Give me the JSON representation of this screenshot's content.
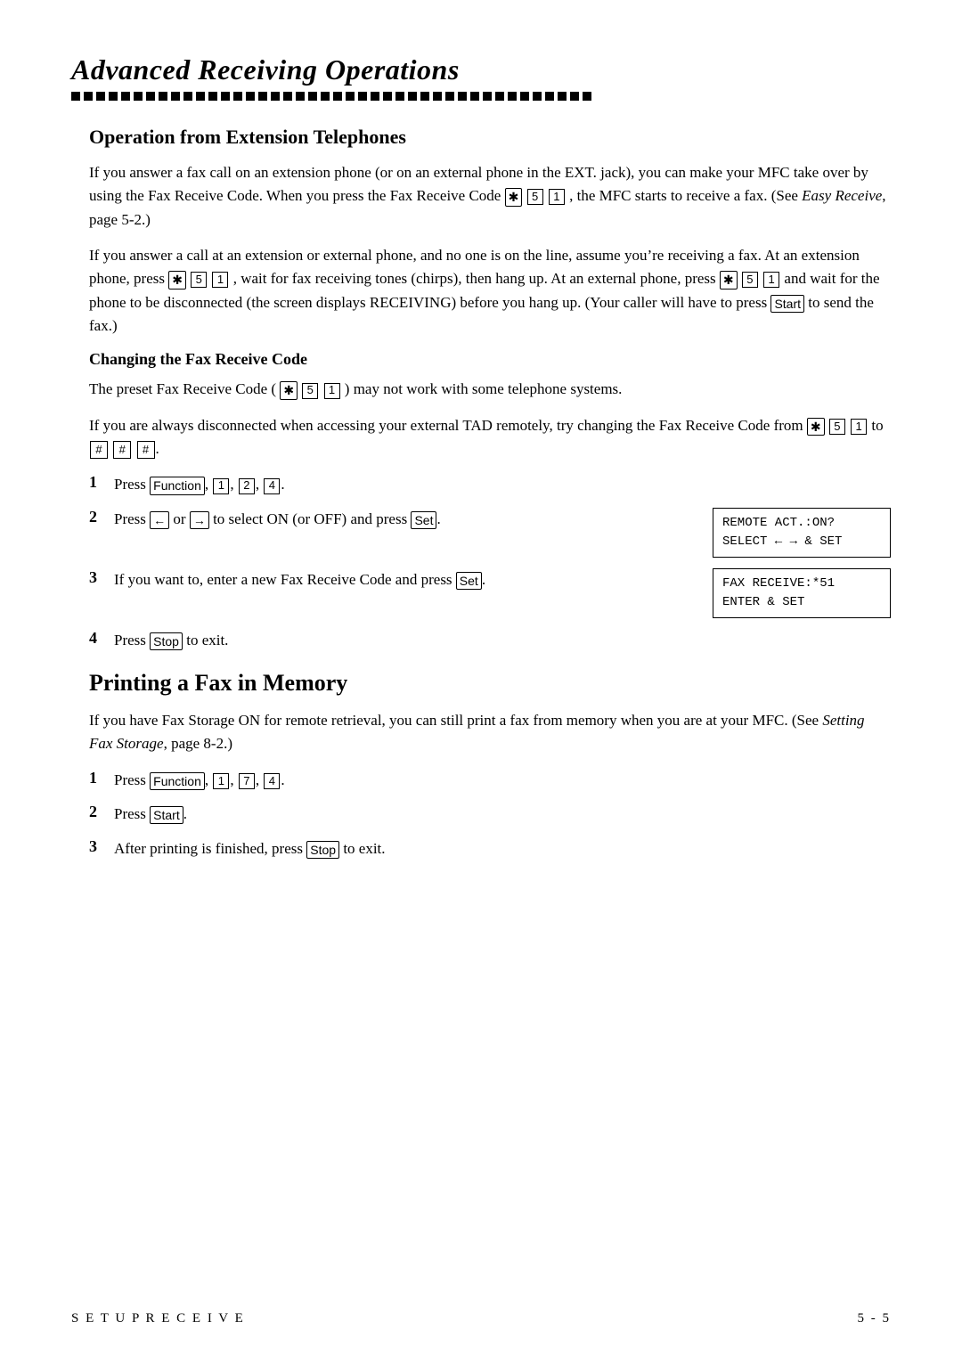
{
  "page": {
    "title": "Advanced Receiving Operations",
    "dots_count": 42,
    "section1": {
      "title": "Operation from Extension Telephones",
      "para1": "If you answer a fax call on an extension phone (or on an external phone in the EXT. jack), you can make your MFC take over by using the Fax Receive Code. When you press the Fax Receive Code",
      "para1_code": "✱ 5 1",
      "para1_end": ", the MFC starts to receive a fax. (See",
      "para1_italic": "Easy Receive",
      "para1_page": ", page 5-2.)",
      "para2": "If you answer a call at an extension or external phone, and no one is on the line, assume you’re receiving a fax. At an extension phone, press",
      "para2_code": "✱ 5 1",
      "para2_mid": ", wait for fax receiving tones (chirps), then hang up.  At an external phone, press",
      "para2_code2": "✱ 5 1",
      "para2_end": "and wait for the phone to be disconnected (the screen displays RECEIVING) before you hang up. (Your caller will have to press",
      "para2_start_btn": "Start",
      "para2_final": "to send the fax.)",
      "subsection": {
        "title": "Changing the Fax Receive Code",
        "para1": "The preset Fax Receive Code (",
        "para1_code": "✱ 5 1",
        "para1_end": ") may not work with some telephone systems.",
        "para2": "If you are always disconnected when accessing your external TAD remotely, try changing the Fax Receive Code from",
        "para2_from": "✱ 5 1",
        "para2_to": "to",
        "para2_to_code": "# # #",
        "steps": [
          {
            "num": "1",
            "text": "Press",
            "btn": "Function",
            "after": ",",
            "keys": [
              "1",
              "2",
              "4"
            ],
            "display": null
          },
          {
            "num": "2",
            "text_pre": "Press",
            "btn_left": "←",
            "or": "or",
            "btn_right": "→",
            "text_after": "to select ON (or OFF) and press",
            "btn_end": "Set",
            "display": "REMOTE ACT.:ON?\nSELECT ← → & SET"
          },
          {
            "num": "3",
            "text": "If you want to, enter a new Fax Receive Code and press",
            "btn": "Set",
            "display": "FAX RECEIVE:*51\nENTER & SET"
          },
          {
            "num": "4",
            "text": "Press",
            "btn": "Stop",
            "after": "to exit."
          }
        ]
      }
    },
    "section2": {
      "title": "Printing a Fax in Memory",
      "para1": "If you have Fax Storage ON for remote retrieval, you can still print a fax from memory when you are at your MFC. (See",
      "para1_italic": "Setting Fax Storage",
      "para1_end": ", page 8-2.)",
      "steps": [
        {
          "num": "1",
          "text": "Press",
          "btn": "Function",
          "keys": [
            "1",
            "7",
            "4"
          ]
        },
        {
          "num": "2",
          "text": "Press",
          "btn": "Start"
        },
        {
          "num": "3",
          "text": "After printing is finished, press",
          "btn": "Stop",
          "after": "to exit."
        }
      ]
    },
    "footer": {
      "left": "S E T U P   R E C E I V E",
      "right": "5 - 5"
    }
  }
}
